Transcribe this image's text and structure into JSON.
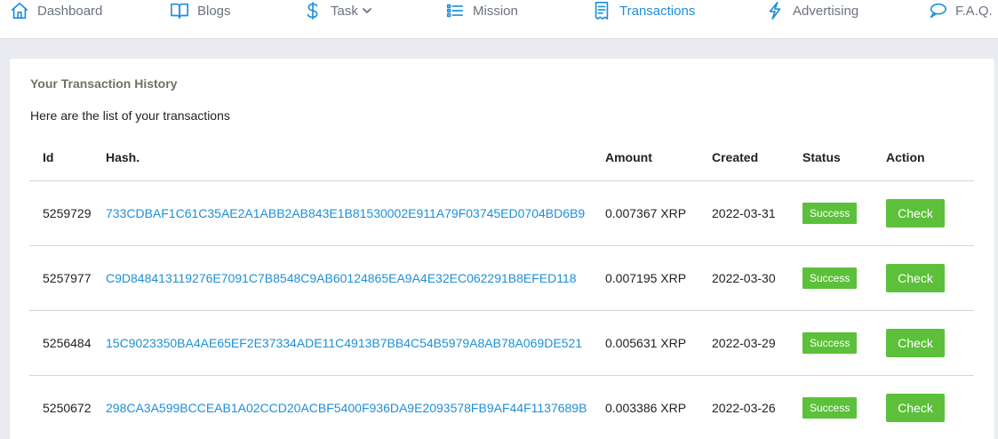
{
  "nav": {
    "items": [
      {
        "label": "Dashboard",
        "icon": "home-icon"
      },
      {
        "label": "Blogs",
        "icon": "book-icon"
      },
      {
        "label": "Task",
        "icon": "dollar-icon",
        "has_dropdown": true
      },
      {
        "label": "Mission",
        "icon": "list-icon"
      },
      {
        "label": "Transactions",
        "icon": "receipt-icon",
        "active": true
      },
      {
        "label": "Advertising",
        "icon": "lightning-icon"
      },
      {
        "label": "F.A.Q.",
        "icon": "chat-icon"
      }
    ]
  },
  "card": {
    "title": "Your Transaction History",
    "subtitle": "Here are the list of your transactions"
  },
  "table": {
    "headers": [
      "Id",
      "Hash.",
      "Amount",
      "Created",
      "Status",
      "Action"
    ],
    "rows": [
      {
        "id": "5259729",
        "hash": "733CDBAF1C61C35AE2A1ABB2AB843E1B81530002E911A79F03745ED0704BD6B9",
        "amount": "0.007367 XRP",
        "created": "2022-03-31",
        "status": "Success",
        "action": "Check"
      },
      {
        "id": "5257977",
        "hash": "C9D848413119276E7091C7B8548C9AB60124865EA9A4E32EC062291B8EFED118",
        "amount": "0.007195 XRP",
        "created": "2022-03-30",
        "status": "Success",
        "action": "Check"
      },
      {
        "id": "5256484",
        "hash": "15C9023350BA4AE65EF2E37334ADE11C4913B7BB4C54B5979A8AB78A069DE521",
        "amount": "0.005631 XRP",
        "created": "2022-03-29",
        "status": "Success",
        "action": "Check"
      },
      {
        "id": "5250672",
        "hash": "298CA3A599BCCEAB1A02CCD20ACBF5400F936DA9E2093578FB9AF44F1137689B",
        "amount": "0.003386 XRP",
        "created": "2022-03-26",
        "status": "Success",
        "action": "Check"
      }
    ]
  },
  "colors": {
    "accent": "#1f8fd6",
    "success": "#5cc03a",
    "page_bg": "#ebecf2"
  }
}
